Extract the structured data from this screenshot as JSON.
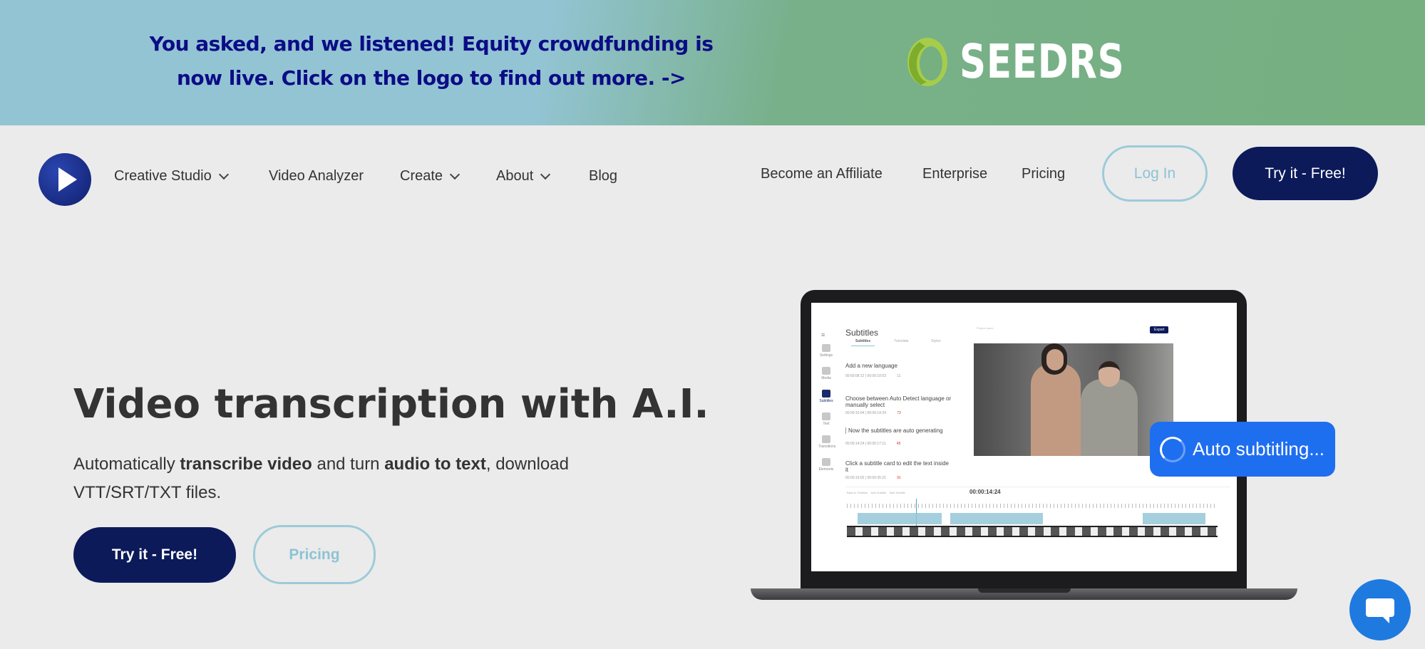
{
  "banner": {
    "line1": "You asked, and we listened! Equity crowdfunding is",
    "line2": "now live. Click on the logo to find out more. ->",
    "logo_text": "SEEDRS",
    "bg_left": "#93c4d4",
    "bg_right": "#76b080",
    "text_color": "#0c0c86"
  },
  "nav": {
    "items": [
      {
        "label": "Creative Studio",
        "dropdown": true
      },
      {
        "label": "Video Analyzer",
        "dropdown": false
      },
      {
        "label": "Create",
        "dropdown": true
      },
      {
        "label": "About",
        "dropdown": true
      },
      {
        "label": "Blog",
        "dropdown": false
      }
    ],
    "right": [
      "Become an Affiliate",
      "Enterprise",
      "Pricing"
    ],
    "login": "Log In",
    "try": "Try it - Free!"
  },
  "hero": {
    "title": "Video transcription with A.I.",
    "sub_parts": [
      "Automatically ",
      "transcribe video",
      " and turn ",
      "audio to text",
      ", download VTT/SRT/TXT files."
    ],
    "try": "Try it - Free!",
    "pricing": "Pricing"
  },
  "app": {
    "title": "Subtitles",
    "tabs": [
      "Subtitles",
      "Translate",
      "Styles"
    ],
    "side": [
      "Settings",
      "Media",
      "Subtitles",
      "Text",
      "Transitions",
      "Elements"
    ],
    "project": "Project name",
    "export": "Export",
    "cards": [
      {
        "text": "Add a new language",
        "start": "00:00:08:12",
        "end": "00:00:10:03",
        "n": "11"
      },
      {
        "text": "Choose between Auto Detect language or manually select",
        "start": "00:00:10:04",
        "end": "00:00:14:24",
        "n": "73"
      },
      {
        "text": "Now the subtitles are auto generating",
        "start": "00:00:14:24",
        "end": "00:00:17:11",
        "n": "45"
      },
      {
        "text": "Click a subtitle card to edit the text inside it",
        "start": "00:00:19:02",
        "end": "00:00:35:21",
        "n": "91"
      }
    ],
    "timeline": {
      "back": "Back to Timeline",
      "add": "Add Subtitle",
      "split": "Split Subtitle",
      "time": "00:00:14:24"
    },
    "overlay": "Auto subtitling..."
  },
  "colors": {
    "navy": "#0c1a5a",
    "outline": "#9ccbd9",
    "chat": "#1f7ae0",
    "overlay": "#1e6ef0"
  }
}
